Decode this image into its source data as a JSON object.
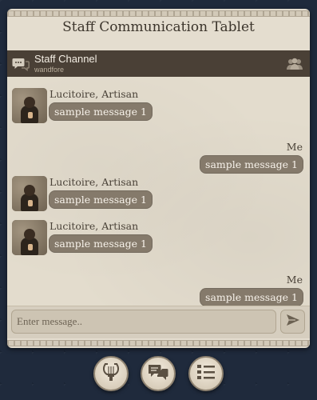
{
  "tablet": {
    "title": "Staff Communication Tablet"
  },
  "channel": {
    "name": "Staff Channel",
    "subtitle": "wandfore",
    "icon": "chat-bubbles-icon",
    "members_icon": "group-icon"
  },
  "messages": [
    {
      "direction": "in",
      "sender": "Lucitoire, Artisan",
      "text": "sample message 1"
    },
    {
      "direction": "out",
      "sender": "Me",
      "text": "sample message 1"
    },
    {
      "direction": "in",
      "sender": "Lucitoire, Artisan",
      "text": "sample message 1"
    },
    {
      "direction": "in",
      "sender": "Lucitoire, Artisan",
      "text": "sample message 1"
    },
    {
      "direction": "out",
      "sender": "Me",
      "text": "sample message 1"
    }
  ],
  "composer": {
    "placeholder": "Enter message..",
    "value": "",
    "send_icon": "send-arrow-icon"
  },
  "bottom_nav": [
    {
      "icon": "lyre-icon"
    },
    {
      "icon": "chat-bubbles-icon"
    },
    {
      "icon": "task-list-icon"
    }
  ],
  "colors": {
    "tablet_bg": "#e4ddcf",
    "channel_bar": "#4a4036",
    "bubble": "#857a6b",
    "page_bg": "#1f2a3c"
  }
}
